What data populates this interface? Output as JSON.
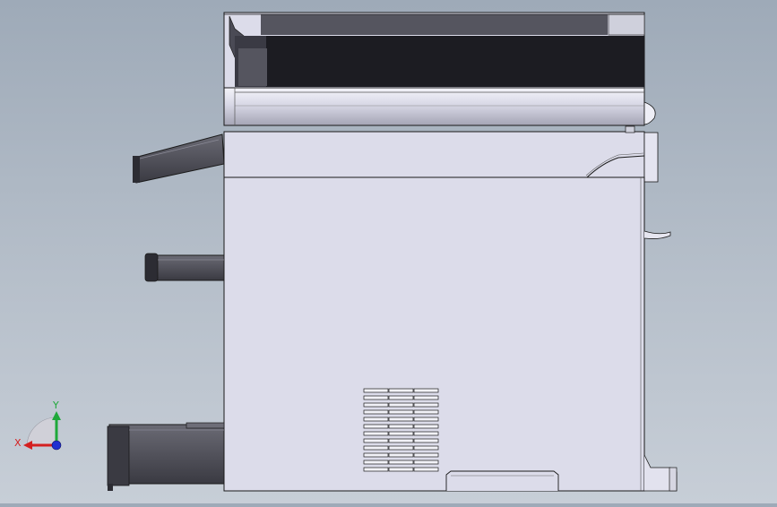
{
  "triad": {
    "x_label": "X",
    "y_label": "Y",
    "x_color": "#d42020",
    "y_color": "#1fa83a",
    "z_color": "#2030d0"
  },
  "colors": {
    "background": "#b0bac6",
    "body": "#dcdcea",
    "outline": "#1a1a1a",
    "dark_trim": "#4a4a55",
    "trays": "#505058"
  }
}
